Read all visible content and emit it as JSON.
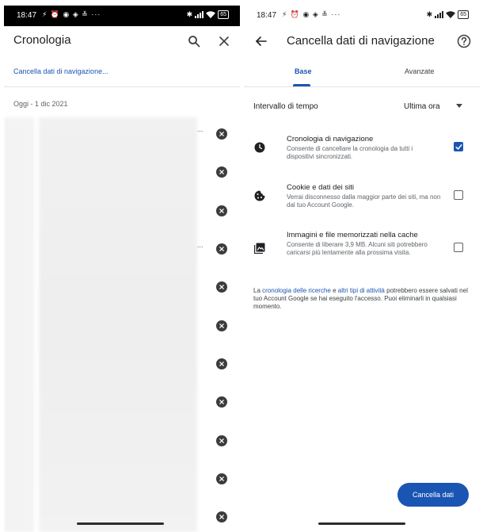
{
  "left_screen": {
    "status": {
      "time": "18:47",
      "icons": "⚡ ⏰ ◉ ◈ ≚ ···",
      "battery": "65"
    },
    "title": "Cronologia",
    "clear_link": "Cancella dati di navigazione...",
    "date_header": "Oggi - 1 dic 2021",
    "row_ellipsis": [
      "...",
      "..."
    ],
    "icons": [
      "search-icon",
      "close-icon",
      "remove-item-icon"
    ]
  },
  "right_screen": {
    "status": {
      "time": "18:47",
      "icons": "⚡ ⏰ ◉ ◈ ≚ ···",
      "battery": "65"
    },
    "title": "Cancella dati di navigazione",
    "tabs": [
      {
        "label": "Base",
        "selected": true
      },
      {
        "label": "Avanzate",
        "selected": false
      }
    ],
    "time_range": {
      "label": "Intervallo di tempo",
      "value": "Ultima ora"
    },
    "options": [
      {
        "title": "Cronologia di navigazione",
        "description": "Consente di cancellare la cronologia da tutti i dispositivi sincronizzati.",
        "checked": true,
        "icon": "clock-icon"
      },
      {
        "title": "Cookie e dati dei siti",
        "description": "Verrai disconnesso dalla maggior parte dei siti, ma non dal tuo Account Google.",
        "checked": false,
        "icon": "cookie-icon"
      },
      {
        "title": "Immagini e file memorizzati nella cache",
        "description": "Consente di liberare 3,9 MB. Alcuni siti potrebbero caricarsi più lentamente alla prossima visita.",
        "checked": false,
        "icon": "image-icon"
      }
    ],
    "footer": {
      "t1": "La ",
      "link1": "cronologia delle ricerche",
      "t2": " e ",
      "link2": "altri tipi di attività",
      "t3": " potrebbero essere salvati nel tuo Account Google se hai eseguito l'accesso. Puoi eliminarli in qualsiasi momento."
    },
    "clear_button": "Cancella dati"
  },
  "colors": {
    "accent": "#1a55b4",
    "text": "#202124",
    "secondary_text": "#5f6368"
  }
}
